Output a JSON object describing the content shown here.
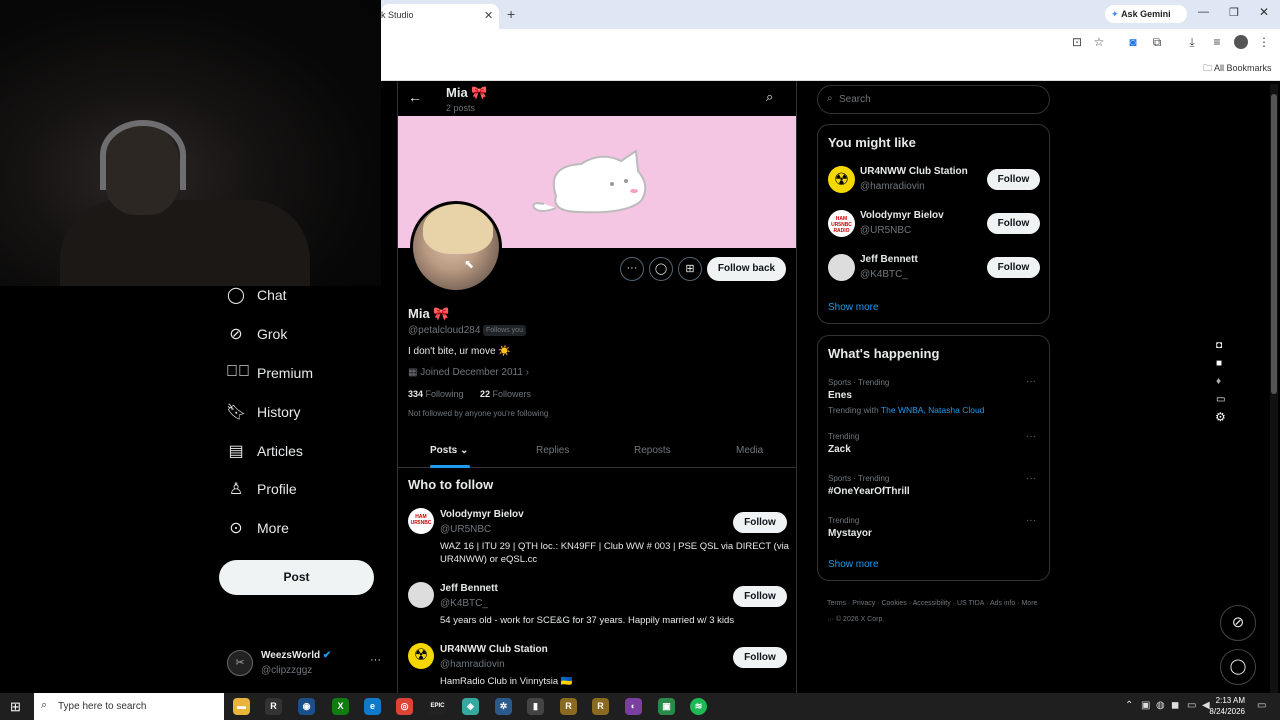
{
  "browser": {
    "tab_title": "k Studio",
    "ask_gemini": "Ask Gemini",
    "all_bookmarks": "All Bookmarks"
  },
  "nav": [
    {
      "label": "Chat",
      "icon": "chat-icon"
    },
    {
      "label": "Grok",
      "icon": "grok-icon"
    },
    {
      "label": "Premium",
      "icon": "premium-icon"
    },
    {
      "label": "History",
      "icon": "bookmark-icon"
    },
    {
      "label": "Articles",
      "icon": "articles-icon"
    },
    {
      "label": "Profile",
      "icon": "profile-icon"
    },
    {
      "label": "More",
      "icon": "more-icon"
    }
  ],
  "post_button": "Post",
  "account": {
    "name": "WeezsWorld",
    "handle": "@clipzzggz"
  },
  "profile": {
    "header_name": "Mia 🎀",
    "post_count": "2 posts",
    "name": "Mia 🎀",
    "handle": "@petalcloud284",
    "follows_you": "Follows you",
    "bio": "I don't bite, ur move ☀️",
    "joined": "Joined December 2011",
    "following_count": "334",
    "following_label": "Following",
    "followers_count": "22",
    "followers_label": "Followers",
    "not_followed": "Not followed by anyone you're following",
    "follow_back": "Follow back"
  },
  "tabs": [
    "Posts",
    "Replies",
    "Reposts",
    "Media"
  ],
  "who_to_follow": {
    "title": "Who to follow",
    "items": [
      {
        "name": "Volodymyr Bielov",
        "handle": "@UR5NBC",
        "bio": "WAZ 16 | ITU 29 | QTH loc.: KN49FF | Club WW # 003 | PSE QSL via DIRECT (via UR4NWW) or eQSL.cc",
        "button": "Follow"
      },
      {
        "name": "Jeff Bennett",
        "handle": "@K4BTC_",
        "bio": "54 years old - work for SCE&G for 37 years. Happily married w/ 3 kids",
        "button": "Follow"
      },
      {
        "name": "UR4NWW Club Station",
        "handle": "@hamradiovin",
        "bio": "HamRadio Club in Vinnytsia 🇺🇦",
        "button": "Follow"
      }
    ]
  },
  "search": {
    "placeholder": "Search"
  },
  "you_might_like": {
    "title": "You might like",
    "items": [
      {
        "name": "UR4NWW Club Station",
        "handle": "@hamradiovin",
        "button": "Follow"
      },
      {
        "name": "Volodymyr Bielov",
        "handle": "@UR5NBC",
        "button": "Follow"
      },
      {
        "name": "Jeff Bennett",
        "handle": "@K4BTC_",
        "button": "Follow"
      }
    ],
    "show_more": "Show more"
  },
  "whats_happening": {
    "title": "What's happening",
    "items": [
      {
        "context": "Sports · Trending",
        "topic": "Enes",
        "extra_prefix": "Trending with",
        "extra_links": "The WNBA, Natasha Cloud"
      },
      {
        "context": "Trending",
        "topic": "Zack"
      },
      {
        "context": "Sports · Trending",
        "topic": "#OneYearOfThrill"
      },
      {
        "context": "Trending",
        "topic": "Mystayor"
      }
    ],
    "show_more": "Show more"
  },
  "footer": {
    "links": [
      "Terms",
      "Privacy",
      "Cookies",
      "Accessibility",
      "US TIDA",
      "Ads info",
      "More ···"
    ],
    "copyright": "© 2026 X Corp."
  },
  "taskbar": {
    "search_placeholder": "Type here to search",
    "time": "2:13 AM",
    "date": "8/24/2026"
  },
  "colors": {
    "accent": "#1d9bf0",
    "banner": "#f4c6e4",
    "bg": "#000000"
  }
}
